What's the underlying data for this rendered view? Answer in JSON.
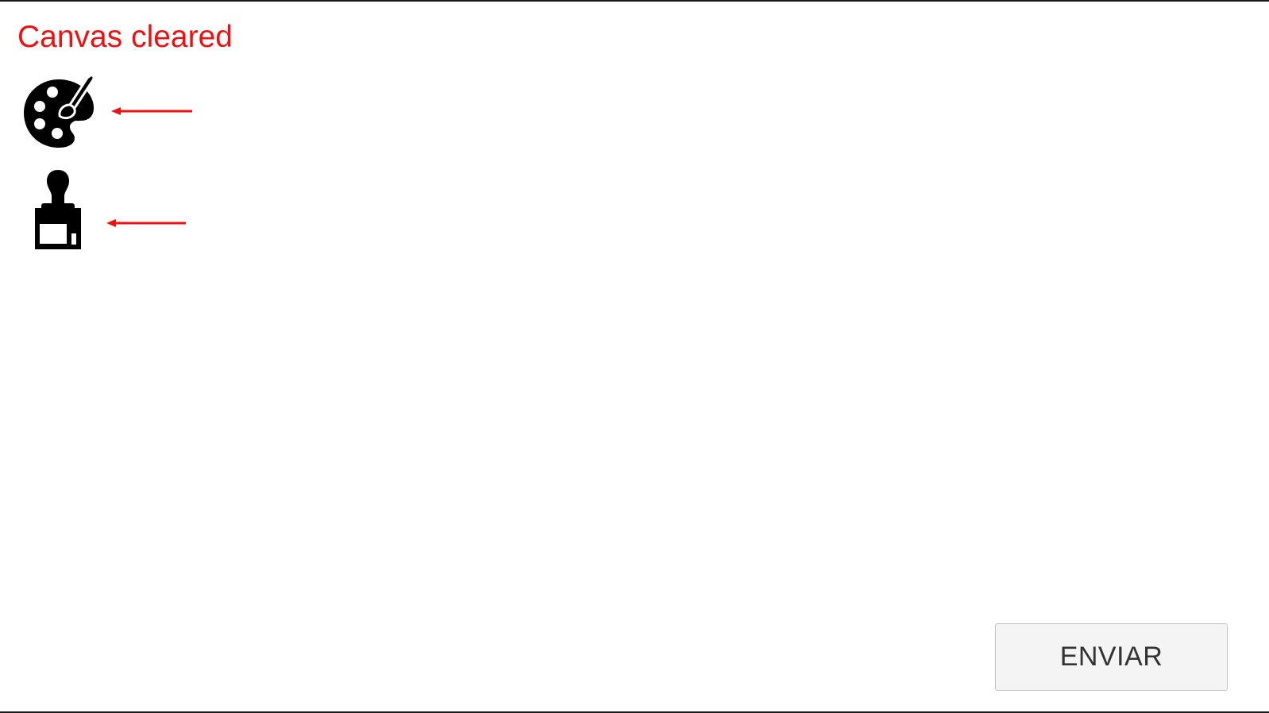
{
  "status": {
    "message": "Canvas cleared",
    "color": "#ee1111"
  },
  "tools": [
    {
      "icon": "palette-icon"
    },
    {
      "icon": "paint-brush-icon"
    }
  ],
  "annotations": {
    "arrow_color": "#ee1111"
  },
  "actions": {
    "send_label": "ENVIAR"
  }
}
